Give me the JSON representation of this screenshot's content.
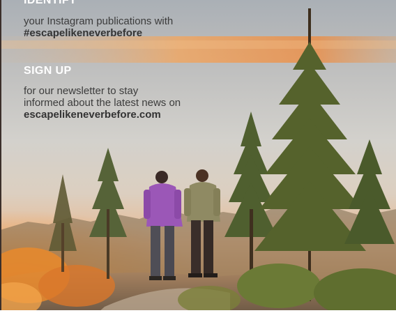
{
  "identify": {
    "heading": "IDENTIFY",
    "line1": "your Instagram publications with",
    "hashtag": "#escapelikeneverbefore"
  },
  "signup": {
    "heading": "SIGN UP",
    "line1": "for our newsletter to stay",
    "line2": "informed about the latest news on",
    "website": "escapelikeneverbefore.com"
  },
  "colors": {
    "heading": "#ffffff",
    "body": "#3c3c3c",
    "sky": "#c9c9c7",
    "sunset": "#f2a24c"
  }
}
